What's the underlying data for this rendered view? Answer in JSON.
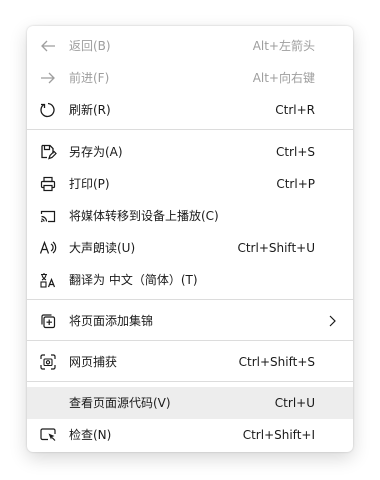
{
  "menu": {
    "items": [
      {
        "label": "返回(B)",
        "shortcut": "Alt+左箭头",
        "icon": "back-arrow-icon",
        "disabled": true
      },
      {
        "label": "前进(F)",
        "shortcut": "Alt+向右键",
        "icon": "forward-arrow-icon",
        "disabled": true
      },
      {
        "label": "刷新(R)",
        "shortcut": "Ctrl+R",
        "icon": "refresh-icon"
      },
      {
        "label": "另存为(A)",
        "shortcut": "Ctrl+S",
        "icon": "save-as-icon"
      },
      {
        "label": "打印(P)",
        "shortcut": "Ctrl+P",
        "icon": "print-icon"
      },
      {
        "label": "将媒体转移到设备上播放(C)",
        "shortcut": "",
        "icon": "cast-icon"
      },
      {
        "label": "大声朗读(U)",
        "shortcut": "Ctrl+Shift+U",
        "icon": "read-aloud-icon"
      },
      {
        "label": "翻译为 中文（简体）(T)",
        "shortcut": "",
        "icon": "translate-icon"
      },
      {
        "label": "将页面添加集锦",
        "shortcut": "",
        "icon": "collections-icon"
      },
      {
        "label": "网页捕获",
        "shortcut": "Ctrl+Shift+S",
        "icon": "screenshot-icon"
      },
      {
        "label": "查看页面源代码(V)",
        "shortcut": "Ctrl+U",
        "icon": "",
        "highlighted": true
      },
      {
        "label": "检查(N)",
        "shortcut": "Ctrl+Shift+I",
        "icon": "inspect-icon"
      }
    ]
  },
  "colors": {
    "text": "#1a1a1a",
    "disabled": "#9e9e9e",
    "hover_bg": "#ededed",
    "separator": "#dcdcdc"
  }
}
